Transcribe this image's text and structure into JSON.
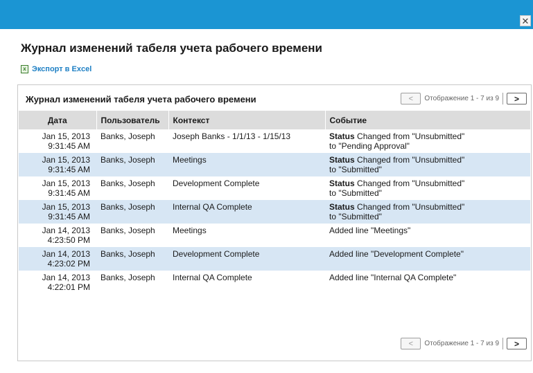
{
  "dialog": {
    "close_symbol": "✕",
    "title": "Журнал изменений табеля учета рабочего времени",
    "export_label": "Экспорт в Excel"
  },
  "panel": {
    "title": "Журнал изменений табеля учета рабочего времени",
    "pager_top": {
      "prev": "<",
      "info": "Отображение 1 - 7 из 9",
      "next": ">"
    },
    "pager_bottom": {
      "prev": "<",
      "info": "Отображение 1 - 7 из 9",
      "next": ">"
    }
  },
  "table": {
    "columns": [
      "Дата",
      "Пользователь",
      "Контекст",
      "Событие"
    ],
    "rows": [
      {
        "date1": "Jan 15, 2013",
        "date2": "9:31:45 AM",
        "user": "Banks, Joseph",
        "context": "Joseph Banks - 1/1/13 - 1/15/13",
        "event_kw": "Status",
        "event1": " Changed from \"Unsubmitted\"",
        "event2": "to \"Pending Approval\""
      },
      {
        "date1": "Jan 15, 2013",
        "date2": "9:31:45 AM",
        "user": "Banks, Joseph",
        "context": "Meetings",
        "event_kw": "Status",
        "event1": " Changed from \"Unsubmitted\"",
        "event2": "to \"Submitted\""
      },
      {
        "date1": "Jan 15, 2013",
        "date2": "9:31:45 AM",
        "user": "Banks, Joseph",
        "context": "Development Complete",
        "event_kw": "Status",
        "event1": " Changed from \"Unsubmitted\"",
        "event2": "to \"Submitted\""
      },
      {
        "date1": "Jan 15, 2013",
        "date2": "9:31:45 AM",
        "user": "Banks, Joseph",
        "context": "Internal QA Complete",
        "event_kw": "Status",
        "event1": " Changed from \"Unsubmitted\"",
        "event2": "to \"Submitted\""
      },
      {
        "date1": "Jan 14, 2013",
        "date2": "4:23:50 PM",
        "user": "Banks, Joseph",
        "context": "Meetings",
        "event_kw": "",
        "event1": "Added line \"Meetings\"",
        "event2": ""
      },
      {
        "date1": "Jan 14, 2013",
        "date2": "4:23:02 PM",
        "user": "Banks, Joseph",
        "context": "Development Complete",
        "event_kw": "",
        "event1": "Added line \"Development Complete\"",
        "event2": ""
      },
      {
        "date1": "Jan 14, 2013",
        "date2": "4:22:01 PM",
        "user": "Banks, Joseph",
        "context": "Internal QA Complete",
        "event_kw": "",
        "event1": "Added line \"Internal QA Complete\"",
        "event2": ""
      }
    ]
  },
  "colors": {
    "topbar": "#1b95d3",
    "alt_row": "#d7e6f4",
    "header": "#dcdcdc",
    "link": "#1d7fc4"
  }
}
